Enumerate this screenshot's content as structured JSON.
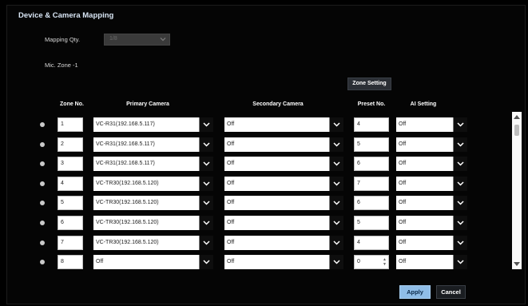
{
  "window": {
    "title": "Device & Camera Mapping"
  },
  "mapping_qty": {
    "label": "Mapping Qty.",
    "value": "1/8"
  },
  "mic_zone": {
    "label": "Mic. Zone -1"
  },
  "zone_setting_button": "Zone Setting",
  "table": {
    "headers": {
      "zone_no": "Zone No.",
      "primary_camera": "Primary Camera",
      "secondary_camera": "Secondary Camera",
      "preset_no": "Preset No.",
      "ai_setting": "AI Setting"
    },
    "rows": [
      {
        "zone": "1",
        "primary": "VC-R31(192.168.5.117)",
        "secondary": "Off",
        "preset": "4",
        "ai": "Off"
      },
      {
        "zone": "2",
        "primary": "VC-R31(192.168.5.117)",
        "secondary": "Off",
        "preset": "5",
        "ai": "Off"
      },
      {
        "zone": "3",
        "primary": "VC-R31(192.168.5.117)",
        "secondary": "Off",
        "preset": "6",
        "ai": "Off"
      },
      {
        "zone": "4",
        "primary": "VC-TR30(192.168.5.120)",
        "secondary": "Off",
        "preset": "7",
        "ai": "Off"
      },
      {
        "zone": "5",
        "primary": "VC-TR30(192.168.5.120)",
        "secondary": "Off",
        "preset": "6",
        "ai": "Off"
      },
      {
        "zone": "6",
        "primary": "VC-TR30(192.168.5.120)",
        "secondary": "Off",
        "preset": "5",
        "ai": "Off"
      },
      {
        "zone": "7",
        "primary": "VC-TR30(192.168.5.120)",
        "secondary": "Off",
        "preset": "4",
        "ai": "Off"
      },
      {
        "zone": "8",
        "primary": "Off",
        "secondary": "Off",
        "preset": "0",
        "ai": "Off"
      }
    ]
  },
  "buttons": {
    "apply": "Apply",
    "cancel": "Cancel"
  },
  "colors": {
    "accent": "#8fbde7",
    "background": "#050505",
    "title": "#d9e6f5"
  }
}
